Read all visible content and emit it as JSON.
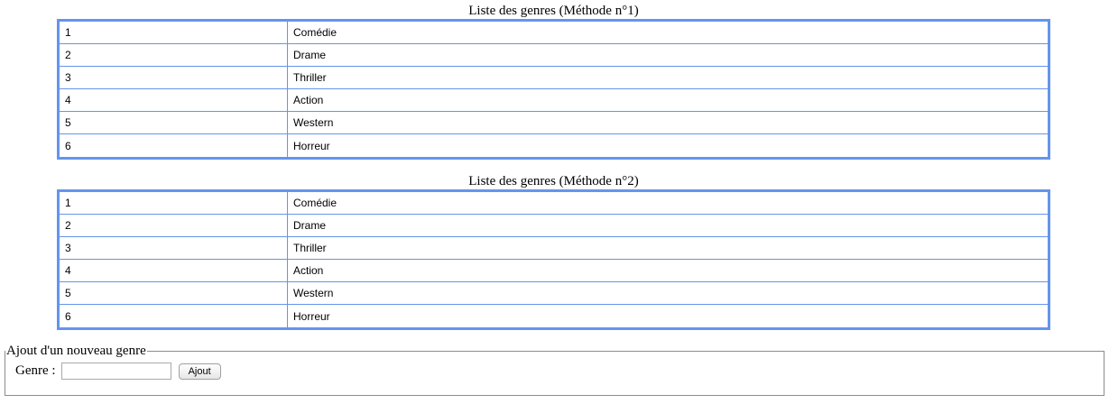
{
  "list1": {
    "caption": "Liste des genres (Méthode n°1)",
    "rows": [
      {
        "id": "1",
        "name": "Comédie"
      },
      {
        "id": "2",
        "name": "Drame"
      },
      {
        "id": "3",
        "name": "Thriller"
      },
      {
        "id": "4",
        "name": "Action"
      },
      {
        "id": "5",
        "name": "Western"
      },
      {
        "id": "6",
        "name": "Horreur"
      }
    ]
  },
  "list2": {
    "caption": "Liste des genres (Méthode n°2)",
    "rows": [
      {
        "id": "1",
        "name": "Comédie"
      },
      {
        "id": "2",
        "name": "Drame"
      },
      {
        "id": "3",
        "name": "Thriller"
      },
      {
        "id": "4",
        "name": "Action"
      },
      {
        "id": "5",
        "name": "Western"
      },
      {
        "id": "6",
        "name": "Horreur"
      }
    ]
  },
  "form": {
    "legend": "Ajout d'un nouveau genre",
    "genre_label": "Genre :",
    "genre_value": "",
    "submit_label": "Ajout"
  },
  "colors": {
    "table_border": "#6495ed"
  }
}
